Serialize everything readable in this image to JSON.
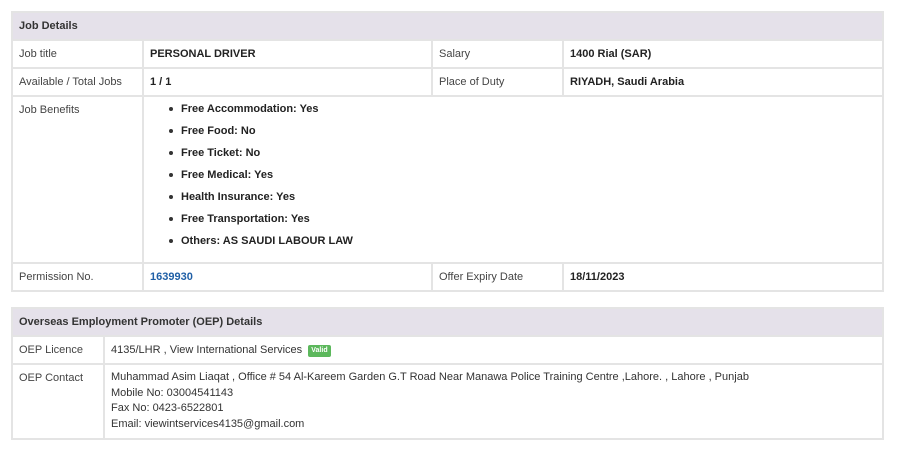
{
  "job_details": {
    "header": "Job Details",
    "job_title_label": "Job title",
    "job_title": "PERSONAL DRIVER",
    "salary_label": "Salary",
    "salary": "1400 Rial (SAR)",
    "jobs_label": "Available / Total Jobs",
    "jobs": "1 / 1",
    "place_label": "Place of Duty",
    "place": "RIYADH, Saudi Arabia",
    "benefits_label": "Job Benefits",
    "benefits": [
      "Free Accommodation: Yes",
      "Free Food: No",
      "Free Ticket: No",
      "Free Medical: Yes",
      "Health Insurance: Yes",
      "Free Transportation: Yes",
      "Others: AS SAUDI LABOUR LAW"
    ],
    "permission_label": "Permission No.",
    "permission_no": "1639930",
    "expiry_label": "Offer Expiry Date",
    "expiry_date": "18/11/2023"
  },
  "oep": {
    "header": "Overseas Employment Promoter (OEP) Details",
    "licence_label": "OEP Licence",
    "licence": "4135/LHR , View International Services",
    "status_badge": "Valid",
    "contact_label": "OEP Contact",
    "contact_address": "Muhammad Asim Liaqat , Office # 54 Al-Kareem Garden G.T Road Near Manawa Police Training Centre ,Lahore. , Lahore , Punjab",
    "mobile": "Mobile No: 03004541143",
    "fax": "Fax No: 0423-6522801",
    "email": "Email: viewintservices4135@gmail.com"
  },
  "colors": {
    "header_bg": "#e5e1ea",
    "border": "#e4e4e4",
    "link": "#1f5fa6",
    "badge_valid": "#5cb85c"
  }
}
